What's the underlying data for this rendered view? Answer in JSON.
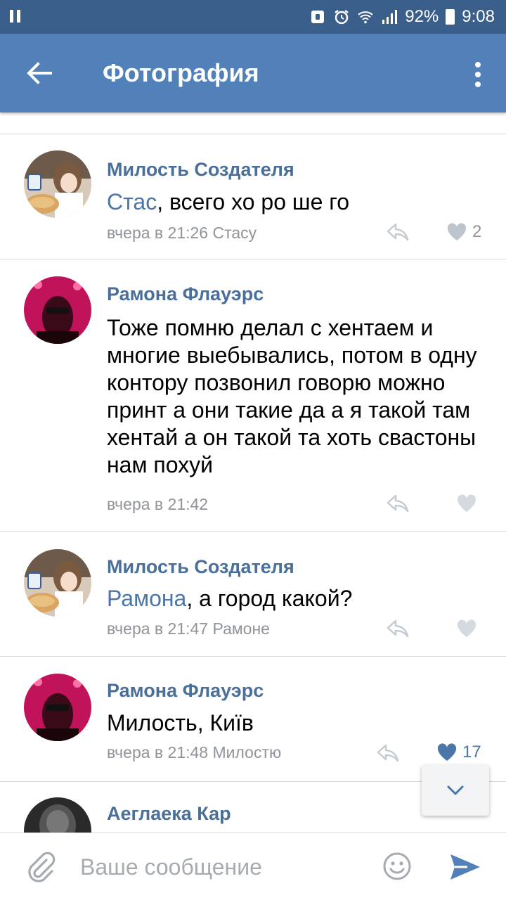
{
  "status_bar": {
    "battery": "92%",
    "time": "9:08",
    "icons": [
      "pause-icon",
      "silent-icon",
      "alarm-icon",
      "wifi-icon",
      "signal-icon",
      "battery-icon"
    ]
  },
  "app_bar": {
    "title": "Фотография",
    "back_icon": "arrow-left-icon",
    "menu_icon": "more-vertical-icon"
  },
  "comments": [
    {
      "author": "Милость Создателя",
      "mention": "Стас",
      "text": ", всего хо ро ше го",
      "meta": "вчера в 21:26 Стасу",
      "likes": "2",
      "liked": false
    },
    {
      "author": "Рамона Флауэрс",
      "text": "Тоже помню делал с хентаем и многие выебывались, потом в одну контору позвонил говорю можно принт а они  такие да а я такой там хентай  а он такой та хоть свастоны нам похуй",
      "meta": "вчера в 21:42",
      "likes": "",
      "liked": false
    },
    {
      "author": "Милость Создателя",
      "mention": "Рамона",
      "text": ", а город какой?",
      "meta": "вчера в 21:47 Рамоне",
      "likes": "",
      "liked": false
    },
    {
      "author": "Рамона Флауэрс",
      "text": "Милость, Київ",
      "meta": "вчера в 21:48 Милостю",
      "likes": "17",
      "liked": true
    },
    {
      "author": "Аеглаека Кар"
    }
  ],
  "composer": {
    "placeholder": "Ваше сообщение"
  },
  "colors": {
    "status_bar": "#3b5f8b",
    "app_bar": "#5181b8",
    "author": "#4a6f9a",
    "mention": "#4a76a8",
    "meta": "#8f949a",
    "like_active": "#4a76a8",
    "divider": "#d7d8db"
  }
}
